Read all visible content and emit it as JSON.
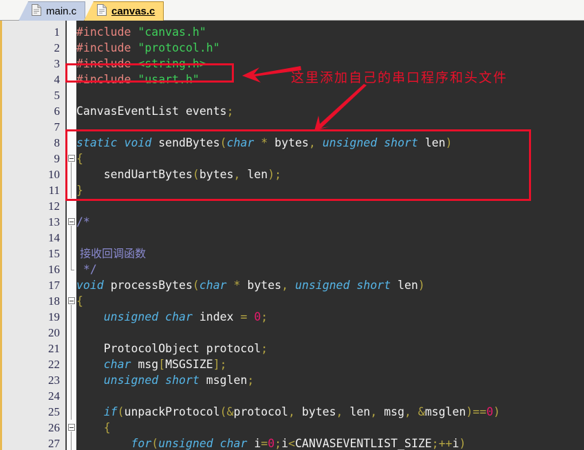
{
  "window": {
    "accent_color": "#e8b951",
    "editor_bg": "#2e2e2e",
    "annotation_color": "#e8102a"
  },
  "tabs": [
    {
      "label": "main.c",
      "active": false,
      "icon": "document-icon"
    },
    {
      "label": "canvas.c",
      "active": true,
      "icon": "document-icon"
    }
  ],
  "annotations": {
    "note_text": "这里添加自己的串口程序和头文件",
    "arrow_horizontal": "left-arrow-icon",
    "arrow_diagonal": "down-left-arrow-icon",
    "box_include": "highlight-box-include-usart",
    "box_function": "highlight-box-sendbytes"
  },
  "editor": {
    "lines": [
      {
        "n": "1",
        "fold": "",
        "html": "<span class='pre'>#include</span> <span class='str'>\"canvas.h\"</span>"
      },
      {
        "n": "2",
        "fold": "",
        "html": "<span class='pre'>#include</span> <span class='str'>\"protocol.h\"</span>"
      },
      {
        "n": "3",
        "fold": "",
        "html": "<span class='pre'>#include</span> <span class='str'>&lt;string.h&gt;</span>"
      },
      {
        "n": "4",
        "fold": "",
        "html": "<span class='pre'>#include</span> <span class='str'>\"usart.h\"</span>"
      },
      {
        "n": "5",
        "fold": "",
        "html": ""
      },
      {
        "n": "6",
        "fold": "",
        "html": "<span class='id'>CanvasEventList</span> <span class='id'>events</span><span class='op'>;</span>"
      },
      {
        "n": "7",
        "fold": "",
        "html": ""
      },
      {
        "n": "8",
        "fold": "",
        "html": "<span class='kw'>static</span> <span class='kw'>void</span> <span class='id'>sendBytes</span><span class='op'>(</span><span class='kw'>char</span> <span class='op'>*</span> <span class='id'>bytes</span><span class='op'>,</span> <span class='kw'>unsigned</span> <span class='kw'>short</span> <span class='id'>len</span><span class='op'>)</span>"
      },
      {
        "n": "9",
        "fold": "box",
        "html": "<span class='op'>{</span>"
      },
      {
        "n": "10",
        "fold": "line",
        "html": "    <span class='id'>sendUartBytes</span><span class='op'>(</span><span class='id'>bytes</span><span class='op'>,</span> <span class='id'>len</span><span class='op'>);</span>"
      },
      {
        "n": "11",
        "fold": "line",
        "html": "<span class='op'>}</span>"
      },
      {
        "n": "12",
        "fold": "",
        "html": ""
      },
      {
        "n": "13",
        "fold": "box",
        "html": "<span class='cmt'>/*</span>"
      },
      {
        "n": "14",
        "fold": "line",
        "html": ""
      },
      {
        "n": "15",
        "fold": "line",
        "html": "<span class='cjk'> 接收回调函数</span>"
      },
      {
        "n": "16",
        "fold": "end",
        "html": "<span class='cmt'> */</span>"
      },
      {
        "n": "17",
        "fold": "",
        "html": "<span class='kw'>void</span> <span class='id'>processBytes</span><span class='op'>(</span><span class='kw'>char</span> <span class='op'>*</span> <span class='id'>bytes</span><span class='op'>,</span> <span class='kw'>unsigned</span> <span class='kw'>short</span> <span class='id'>len</span><span class='op'>)</span>"
      },
      {
        "n": "18",
        "fold": "box",
        "html": "<span class='op'>{</span>"
      },
      {
        "n": "19",
        "fold": "line",
        "html": "    <span class='kw'>unsigned</span> <span class='kw'>char</span> <span class='id'>index</span> <span class='op'>=</span> <span class='num'>0</span><span class='op'>;</span>"
      },
      {
        "n": "20",
        "fold": "line",
        "html": ""
      },
      {
        "n": "21",
        "fold": "line",
        "html": "    <span class='id'>ProtocolObject</span> <span class='id'>protocol</span><span class='op'>;</span>"
      },
      {
        "n": "22",
        "fold": "line",
        "html": "    <span class='kw'>char</span> <span class='id'>msg</span><span class='op'>[</span><span class='id'>MSGSIZE</span><span class='op'>];</span>"
      },
      {
        "n": "23",
        "fold": "line",
        "html": "    <span class='kw'>unsigned</span> <span class='kw'>short</span> <span class='id'>msglen</span><span class='op'>;</span>"
      },
      {
        "n": "24",
        "fold": "line",
        "html": ""
      },
      {
        "n": "25",
        "fold": "line",
        "html": "    <span class='kw'>if</span><span class='op'>(</span><span class='id'>unpackProtocol</span><span class='op'>(&amp;</span><span class='id'>protocol</span><span class='op'>,</span> <span class='id'>bytes</span><span class='op'>,</span> <span class='id'>len</span><span class='op'>,</span> <span class='id'>msg</span><span class='op'>,</span> <span class='op'>&amp;</span><span class='id'>msglen</span><span class='op'>)==</span><span class='num'>0</span><span class='op'>)</span>"
      },
      {
        "n": "26",
        "fold": "box",
        "html": "    <span class='op'>{</span>"
      },
      {
        "n": "27",
        "fold": "line",
        "html": "        <span class='kw'>for</span><span class='op'>(</span><span class='kw'>unsigned</span> <span class='kw'>char</span> <span class='id'>i</span><span class='op'>=</span><span class='num'>0</span><span class='op'>;</span><span class='id'>i</span><span class='op'>&lt;</span><span class='id'>CANVASEVENTLIST_SIZE</span><span class='op'>;++</span><span class='id'>i</span><span class='op'>)</span>"
      }
    ]
  }
}
